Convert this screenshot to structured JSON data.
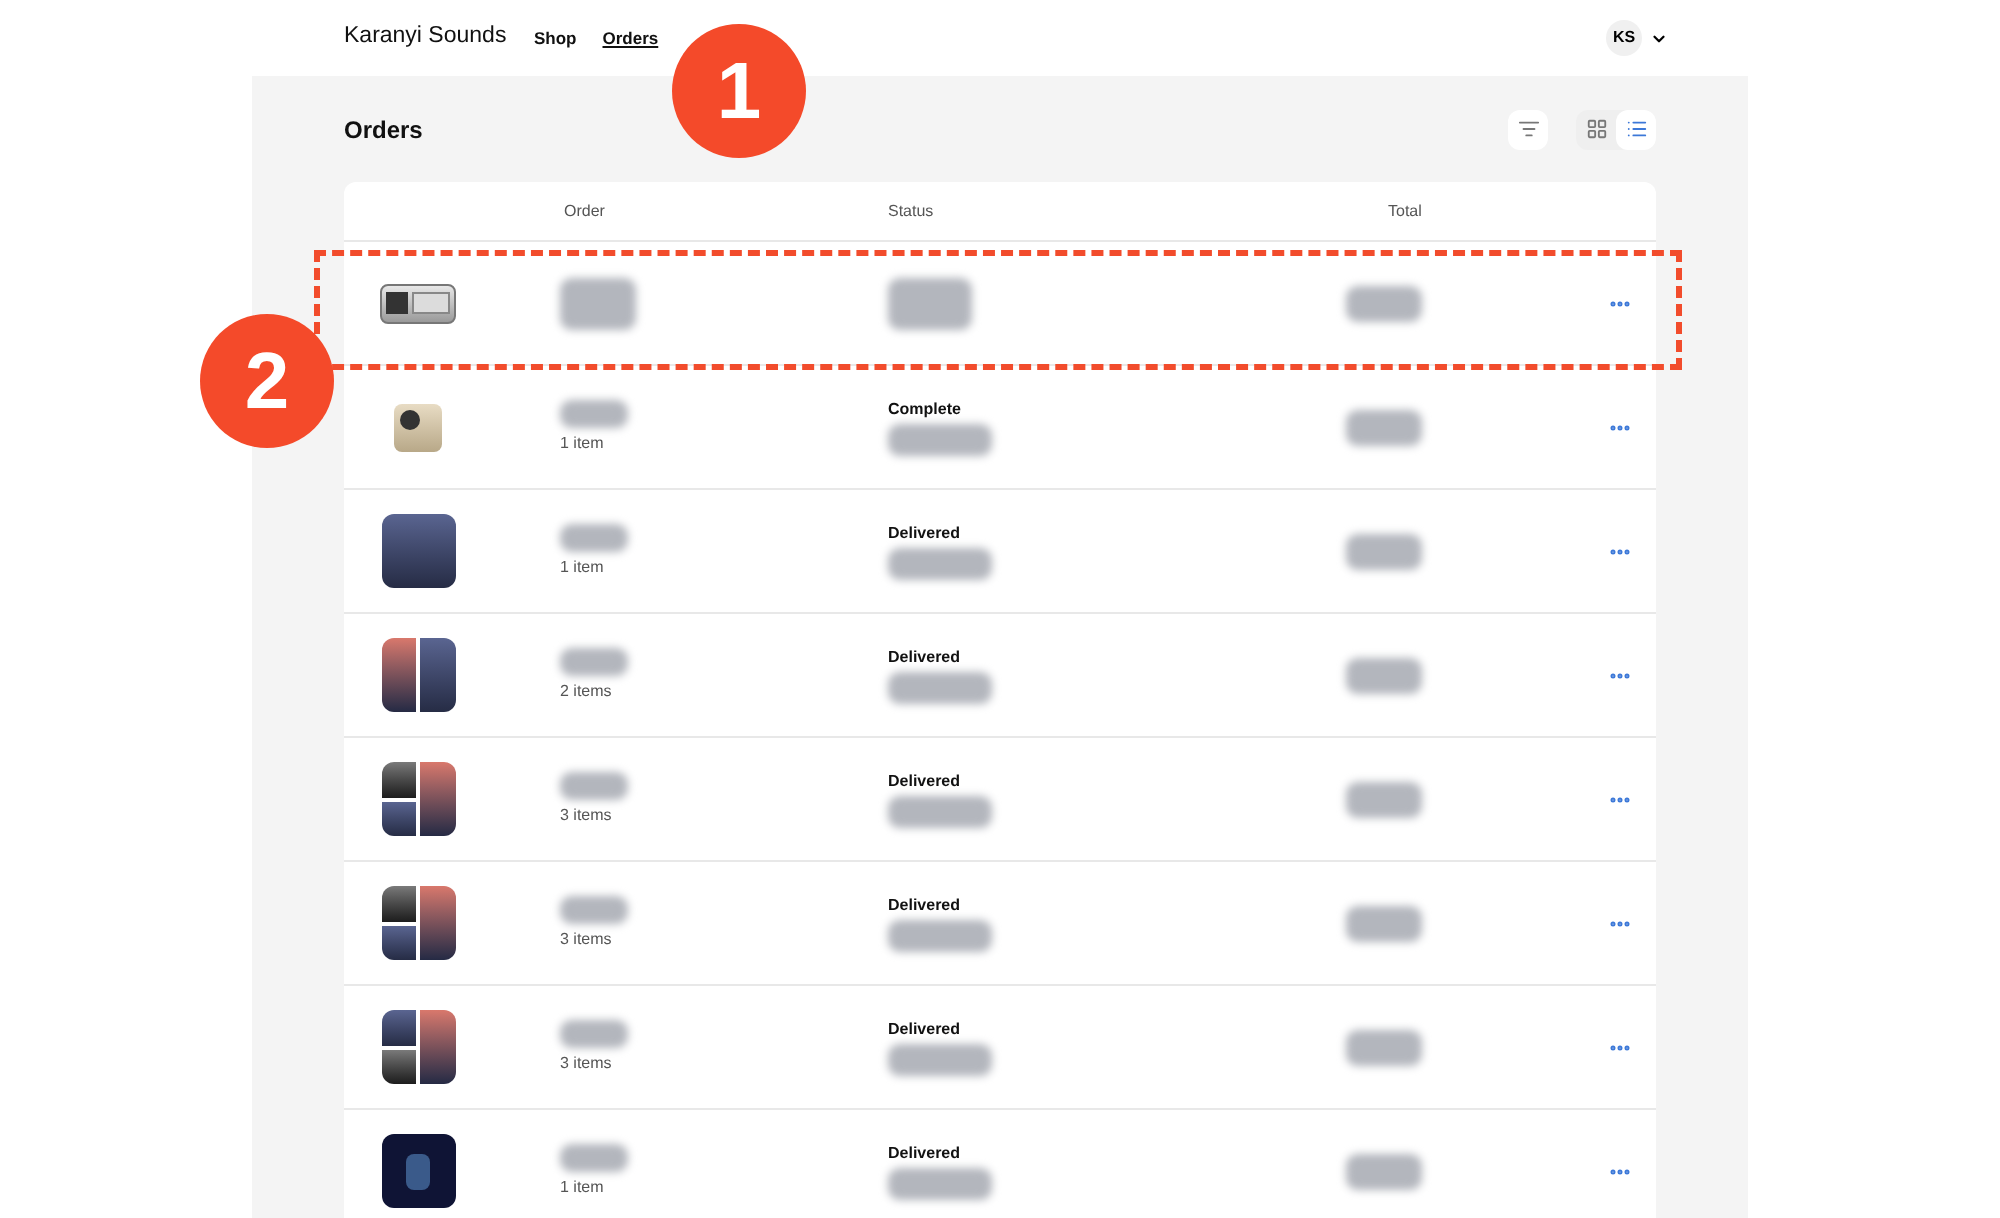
{
  "nav": {
    "brand": "Karanyi Sounds",
    "links": [
      {
        "label": "Shop",
        "selected": false
      },
      {
        "label": "Orders",
        "selected": true
      }
    ],
    "avatar": "KS"
  },
  "page": {
    "title": "Orders",
    "views": [
      {
        "kind": "grid",
        "selected": false
      },
      {
        "kind": "list",
        "selected": true
      }
    ]
  },
  "table": {
    "columns": [
      "Order",
      "Status",
      "Total"
    ],
    "rows": [
      {
        "kind": "device",
        "items": "",
        "status": "",
        "highlighted": true
      },
      {
        "kind": "beige",
        "items": "1 item",
        "status": "Complete",
        "highlighted": false
      },
      {
        "kind": "single",
        "items": "1 item",
        "status": "Delivered",
        "highlighted": false
      },
      {
        "kind": "pair",
        "items": "2 items",
        "status": "Delivered",
        "highlighted": false
      },
      {
        "kind": "trio",
        "items": "3 items",
        "status": "Delivered",
        "highlighted": false
      },
      {
        "kind": "trio",
        "items": "3 items",
        "status": "Delivered",
        "highlighted": false
      },
      {
        "kind": "trio2",
        "items": "3 items",
        "status": "Delivered",
        "highlighted": false
      },
      {
        "kind": "dark",
        "items": "1 item",
        "status": "Delivered",
        "highlighted": false
      }
    ]
  },
  "callouts": [
    "1",
    "2"
  ]
}
